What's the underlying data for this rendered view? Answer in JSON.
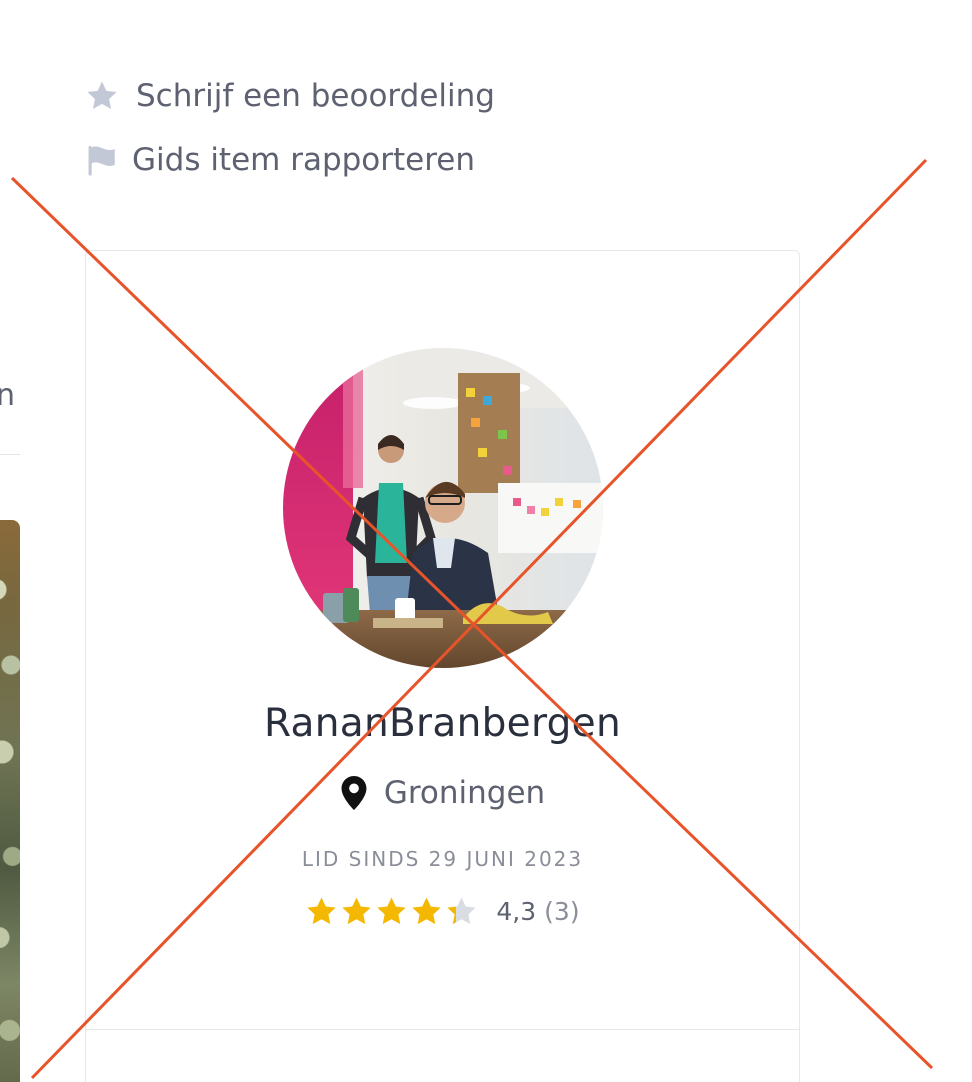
{
  "actions": {
    "review_label": "Schrijf een beoordeling",
    "report_label": "Gids item rapporteren"
  },
  "left_column": {
    "partial_text": "n"
  },
  "profile": {
    "username": "RananBranbergen",
    "location": "Groningen",
    "member_since": "LID SINDS 29 JUNI 2023",
    "rating_value": "4,3",
    "rating_count": "(3)",
    "stars_filled": 4.3,
    "stars_total": 5
  },
  "colors": {
    "star_filled": "#f5b800",
    "star_empty": "#d9dce2",
    "icon_muted": "#c3c8d6",
    "overlay_x": "#e8542a",
    "text_dark": "#2a2f3d",
    "text_muted": "#5d6170"
  },
  "icons": {
    "review": "star-icon",
    "report": "flag-icon",
    "location": "map-pin-icon"
  }
}
